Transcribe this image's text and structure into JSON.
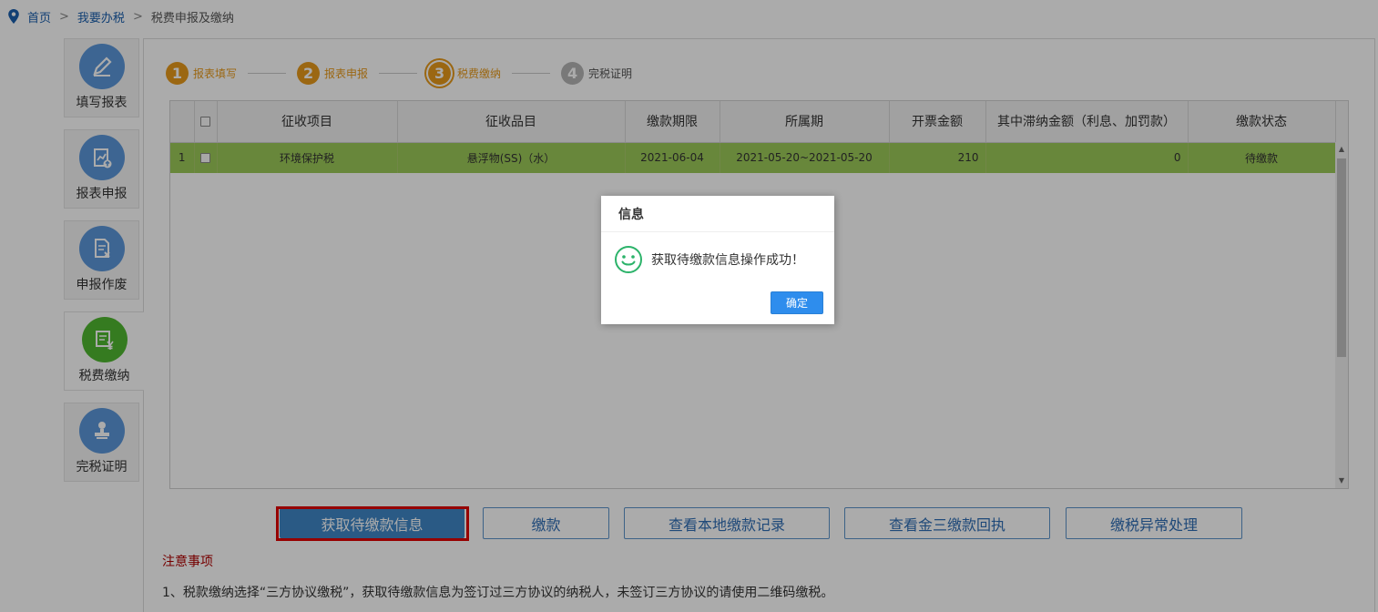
{
  "breadcrumb": {
    "home": "首页",
    "sep1": ">",
    "level2": "我要办税",
    "sep2": ">",
    "current": "税费申报及缴纳"
  },
  "sidebar": {
    "items": [
      {
        "label": "填写报表",
        "icon": "pencil-icon",
        "active": false
      },
      {
        "label": "报表申报",
        "icon": "report-upload-icon",
        "active": false
      },
      {
        "label": "申报作废",
        "icon": "document-cancel-icon",
        "active": false
      },
      {
        "label": "税费缴纳",
        "icon": "tax-payment-icon",
        "active": true
      },
      {
        "label": "完税证明",
        "icon": "stamp-icon",
        "active": false
      }
    ]
  },
  "steps": [
    {
      "num": "1",
      "label": "报表填写"
    },
    {
      "num": "2",
      "label": "报表申报"
    },
    {
      "num": "3",
      "label": "税费缴纳"
    },
    {
      "num": "4",
      "label": "完税证明"
    }
  ],
  "table": {
    "headers": [
      "征收项目",
      "征收品目",
      "缴款期限",
      "所属期",
      "开票金额",
      "其中滞纳金额（利息、加罚款）",
      "缴款状态"
    ],
    "rows": [
      {
        "index": "1",
        "item": "环境保护税",
        "subitem": "悬浮物(SS)（水）",
        "deadline": "2021-06-04",
        "period": "2021-05-20~2021-05-20",
        "amount": "210",
        "late_fee": "0",
        "status": "待缴款"
      }
    ]
  },
  "buttons": {
    "fetch": "获取待缴款信息",
    "pay": "缴款",
    "local_records": "查看本地缴款记录",
    "jinsan_receipt": "查看金三缴款回执",
    "exception": "缴税异常处理"
  },
  "notes": {
    "title": "注意事项",
    "line1": "1、税款缴纳选择“三方协议缴税”，获取待缴款信息为签订过三方协议的纳税人，未签订三方协议的请使用二维码缴税。"
  },
  "dialog": {
    "title": "信息",
    "message": "获取待缴款信息操作成功！",
    "ok": "确定"
  },
  "colors": {
    "step_active": "#e89a1c",
    "step_inactive": "#b5b5b5",
    "selected_row": "#9cc958",
    "primary_button": "#3f86c6",
    "sidebar_icon": "#4a8fd9",
    "sidebar_icon_active": "#4fb830",
    "highlight_border": "#e00000"
  }
}
